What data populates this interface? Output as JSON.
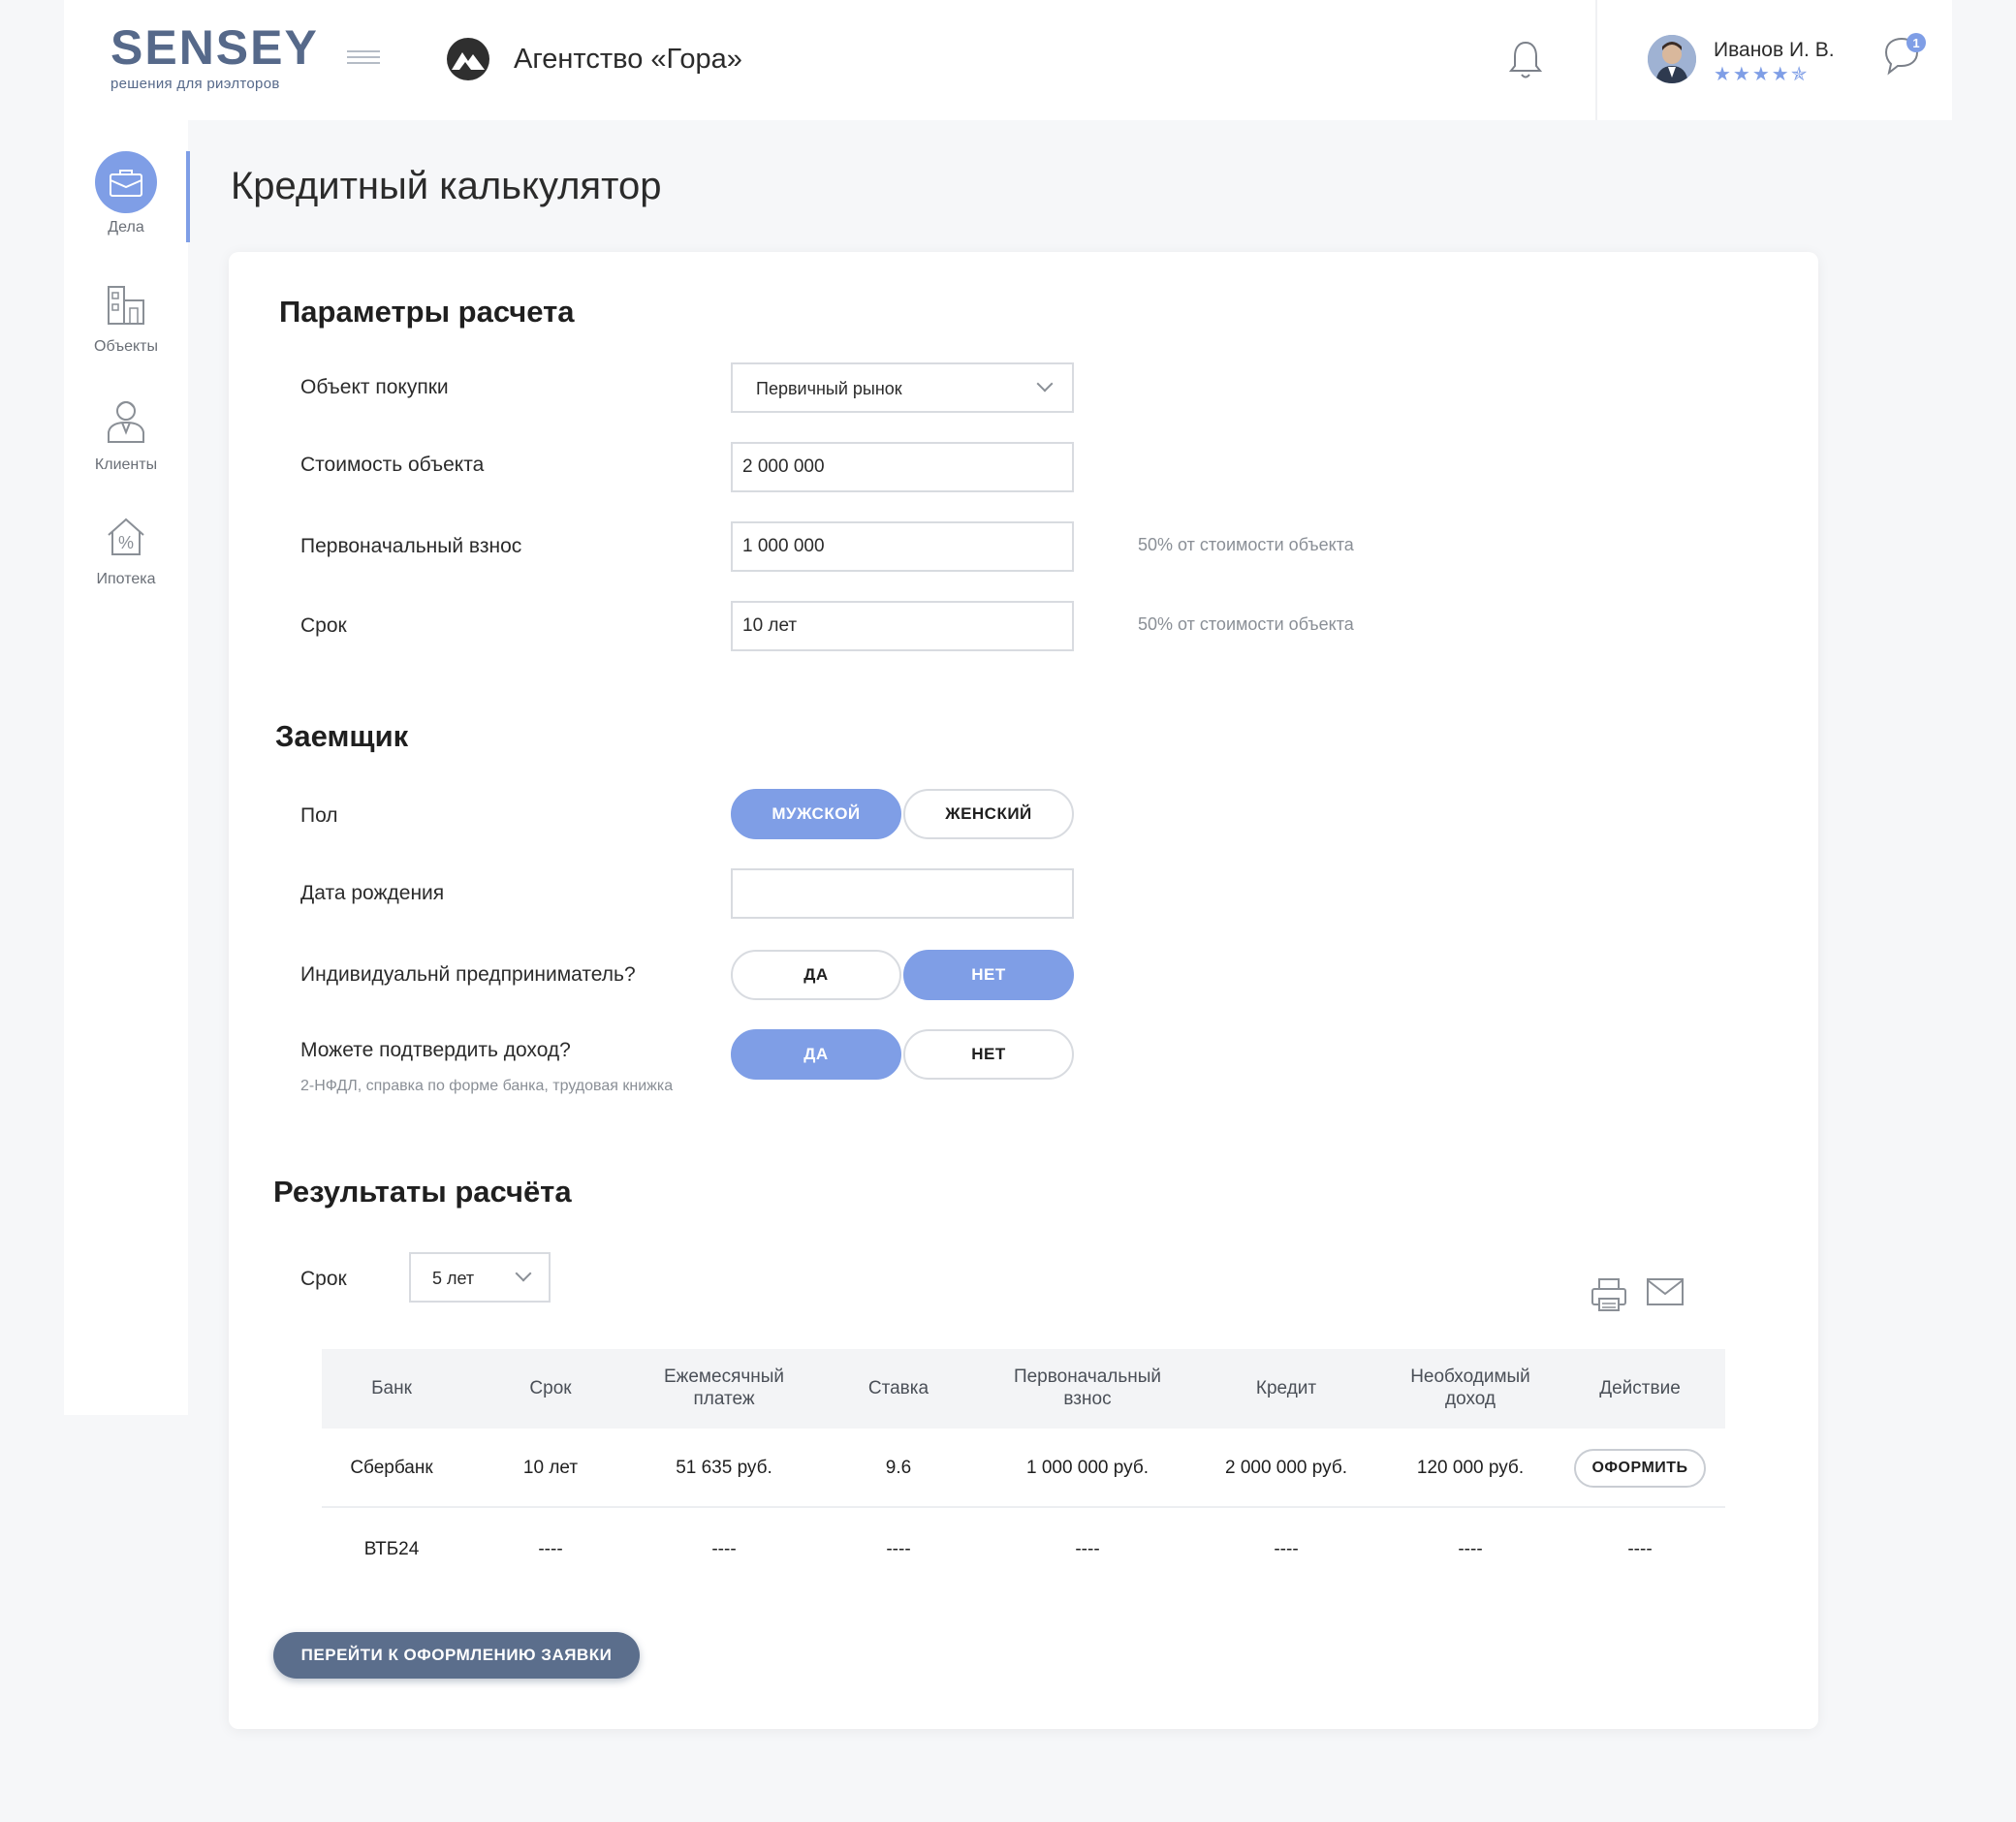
{
  "brand": {
    "name": "SENSEY",
    "tagline": "решения для риэлторов",
    "color": "#56698a"
  },
  "header": {
    "agency_name": "Агентство «Гора»",
    "user_name": "Иванов И. В.",
    "rating_stars": "★★★★✯",
    "rating": 4.5,
    "chat_badge": "1"
  },
  "sidebar": {
    "items": [
      {
        "label": "Дела",
        "icon": "briefcase-icon",
        "active": true
      },
      {
        "label": "Объекты",
        "icon": "buildings-icon"
      },
      {
        "label": "Клиенты",
        "icon": "client-icon"
      },
      {
        "label": "Ипотека",
        "icon": "mortgage-icon"
      }
    ]
  },
  "page": {
    "title": "Кредитный калькулятор"
  },
  "params": {
    "title": "Параметры расчета",
    "purchase_label": "Объект покупки",
    "purchase_value": "Первичный рынок",
    "cost_label": "Стоимость объекта",
    "cost_value": "2 000 000",
    "down_label": "Первоначальный взнос",
    "down_value": "1 000 000",
    "down_hint": "50% от стоимости объекта",
    "term_label": "Срок",
    "term_value": "10 лет",
    "term_hint": "50% от стоимости объекта"
  },
  "borrower": {
    "title": "Заемщик",
    "gender_label": "Пол",
    "gender_male": "МУЖСКОЙ",
    "gender_female": "ЖЕНСКИЙ",
    "birth_label": "Дата рождения",
    "birth_value": "",
    "ie_label": "Индивидуальнй предприниматель?",
    "ie_yes": "ДА",
    "ie_no": "НЕТ",
    "income_label": "Можете подтвердить доход?",
    "income_hint": "2-НФДЛ, справка по форме банка, трудовая книжка",
    "income_yes": "ДА",
    "income_no": "НЕТ"
  },
  "results": {
    "title": "Результаты расчёта",
    "term_label": "Срок",
    "term_value": "5 лет",
    "columns": [
      "Банк",
      "Срок",
      "Ежемесячный платеж",
      "Ставка",
      "Первоначальный взнос",
      "Кредит",
      "Необходимый доход",
      "Действие"
    ],
    "rows": [
      [
        "Сбербанк",
        "10 лет",
        "51 635 руб.",
        "9.6",
        "1 000 000 руб.",
        "2 000 000 руб.",
        "120 000 руб.",
        "ОФОРМИТЬ"
      ],
      [
        "ВТБ24",
        "----",
        "----",
        "----",
        "----",
        "----",
        "----",
        "----"
      ]
    ],
    "cta_label": "ПЕРЕЙТИ К ОФОРМЛЕНИЮ ЗАЯВКИ"
  },
  "colors": {
    "accent": "#7f9ee6",
    "cta": "#5b6e8c",
    "background": "#f6f7f9"
  }
}
